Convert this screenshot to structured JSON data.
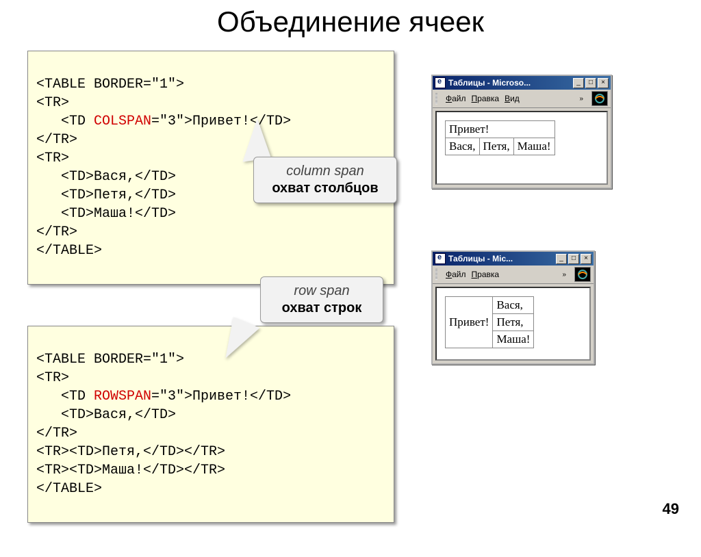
{
  "title": "Объединение ячеек",
  "page_number": "49",
  "code1": {
    "l1": "<TABLE BORDER=\"1\">",
    "l2": "<TR>",
    "l3a": "   <TD ",
    "l3b": "COLSPAN",
    "l3c": "=\"3\">Привет!</TD>",
    "l4": "</TR>",
    "l5": "<TR>",
    "l6": "   <TD>Вася,</TD>",
    "l7": "   <TD>Петя,</TD>",
    "l8": "   <TD>Маша!</TD>",
    "l9": "</TR>",
    "l10": "</TABLE>"
  },
  "code2": {
    "l1": "<TABLE BORDER=\"1\">",
    "l2": "<TR>",
    "l3a": "   <TD ",
    "l3b": "ROWSPAN",
    "l3c": "=\"3\">Привет!</TD>",
    "l4": "   <TD>Вася,</TD>",
    "l5": "</TR>",
    "l6": "<TR><TD>Петя,</TD></TR>",
    "l7": "<TR><TD>Маша!</TD></TR>",
    "l8": "</TABLE>"
  },
  "callout1": {
    "line1": "column span",
    "line2": "охват столбцов"
  },
  "callout2": {
    "line1": "row span",
    "line2": "охват строк"
  },
  "win1": {
    "title": "Таблицы - Microso...",
    "menu": {
      "file": "Файл",
      "edit": "Правка",
      "view": "Вид"
    },
    "table": {
      "r1c1": "Привет!",
      "r2c1": "Вася,",
      "r2c2": "Петя,",
      "r2c3": "Маша!"
    }
  },
  "win2": {
    "title": "Таблицы - Mic...",
    "menu": {
      "file": "Файл",
      "edit": "Правка"
    },
    "table": {
      "colA": "Привет!",
      "r1": "Вася,",
      "r2": "Петя,",
      "r3": "Маша!"
    }
  }
}
